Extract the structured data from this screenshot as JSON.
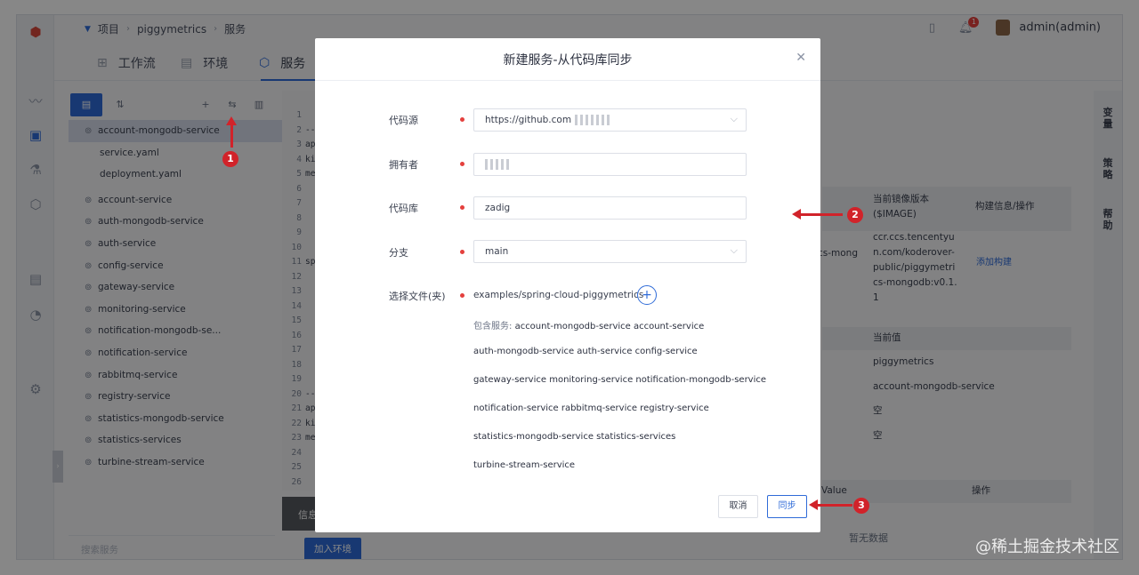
{
  "topbar": {
    "breadcrumb": [
      "项目",
      "piggymetrics",
      "服务"
    ],
    "notification_count": "1",
    "user": "admin(admin)"
  },
  "tabs": [
    {
      "label": "工作流",
      "icon": "workflow-icon"
    },
    {
      "label": "环境",
      "icon": "environment-icon"
    },
    {
      "label": "服务",
      "icon": "service-icon",
      "active": true
    }
  ],
  "services": [
    {
      "label": "account-mongodb-service",
      "selected": true
    },
    {
      "label": "service.yaml",
      "sub": true
    },
    {
      "label": "deployment.yaml",
      "sub": true
    },
    {
      "label": "account-service"
    },
    {
      "label": "auth-mongodb-service"
    },
    {
      "label": "auth-service"
    },
    {
      "label": "config-service"
    },
    {
      "label": "gateway-service"
    },
    {
      "label": "monitoring-service"
    },
    {
      "label": "notification-mongodb-se..."
    },
    {
      "label": "notification-service"
    },
    {
      "label": "rabbitmq-service"
    },
    {
      "label": "registry-service"
    },
    {
      "label": "statistics-mongodb-service"
    },
    {
      "label": "statistics-services"
    },
    {
      "label": "turbine-stream-service"
    }
  ],
  "search_placeholder": "搜索服务",
  "editor": {
    "line_numbers": [
      "1",
      "2",
      "3",
      "4",
      "5",
      "6",
      "7",
      "8",
      "9",
      "10",
      "11",
      "12",
      "13",
      "14",
      "15",
      "16",
      "17",
      "18",
      "19",
      "20",
      "21",
      "22",
      "23",
      "24",
      "25",
      "26"
    ],
    "code_fragments": {
      "2": "--",
      "3": "ap",
      "4": "ki",
      "5": "me",
      "11": "sp",
      "20": "--",
      "21": "ap",
      "22": "ki",
      "23": "me"
    }
  },
  "info_label": "信息",
  "add_env_label": "加入环境",
  "right_panel": {
    "image_header": "当前镜像版本($IMAGE)",
    "build_header": "构建信息/操作",
    "container_name_partial": "cs-mong",
    "image_value": "ccr.ccs.tencentyun.com/koderover-public/piggymetrics-mongodb:v0.1.1",
    "add_build": "添加构建",
    "current_value_header": "当前值",
    "values": [
      "piggymetrics",
      "account-mongodb-service",
      "空",
      "空"
    ],
    "value_header": "Value",
    "op_header": "操作",
    "empty_text": "暂无数据"
  },
  "vertical_tabs": [
    "变量",
    "策略",
    "帮助"
  ],
  "modal": {
    "title": "新建服务-从代码库同步",
    "fields": {
      "source_label": "代码源",
      "source_value": "https://github.com",
      "owner_label": "拥有者",
      "repo_label": "代码库",
      "repo_value": "zadig",
      "branch_label": "分支",
      "branch_value": "main",
      "path_label": "选择文件(夹)",
      "path_value": "examples/spring-cloud-piggymetrics"
    },
    "included_prefix": "包含服务:",
    "included_lines": [
      "account-mongodb-service account-service",
      "auth-mongodb-service auth-service config-service",
      "gateway-service monitoring-service notification-mongodb-service",
      "notification-service rabbitmq-service registry-service",
      "statistics-mongodb-service statistics-services",
      "turbine-stream-service"
    ],
    "cancel_label": "取消",
    "sync_label": "同步"
  },
  "annotations": [
    "1",
    "2",
    "3"
  ],
  "watermark": "@稀土掘金技术社区",
  "colors": {
    "accent": "#2f6bd8",
    "annotation": "#d1232a",
    "required": "#e4403d"
  }
}
